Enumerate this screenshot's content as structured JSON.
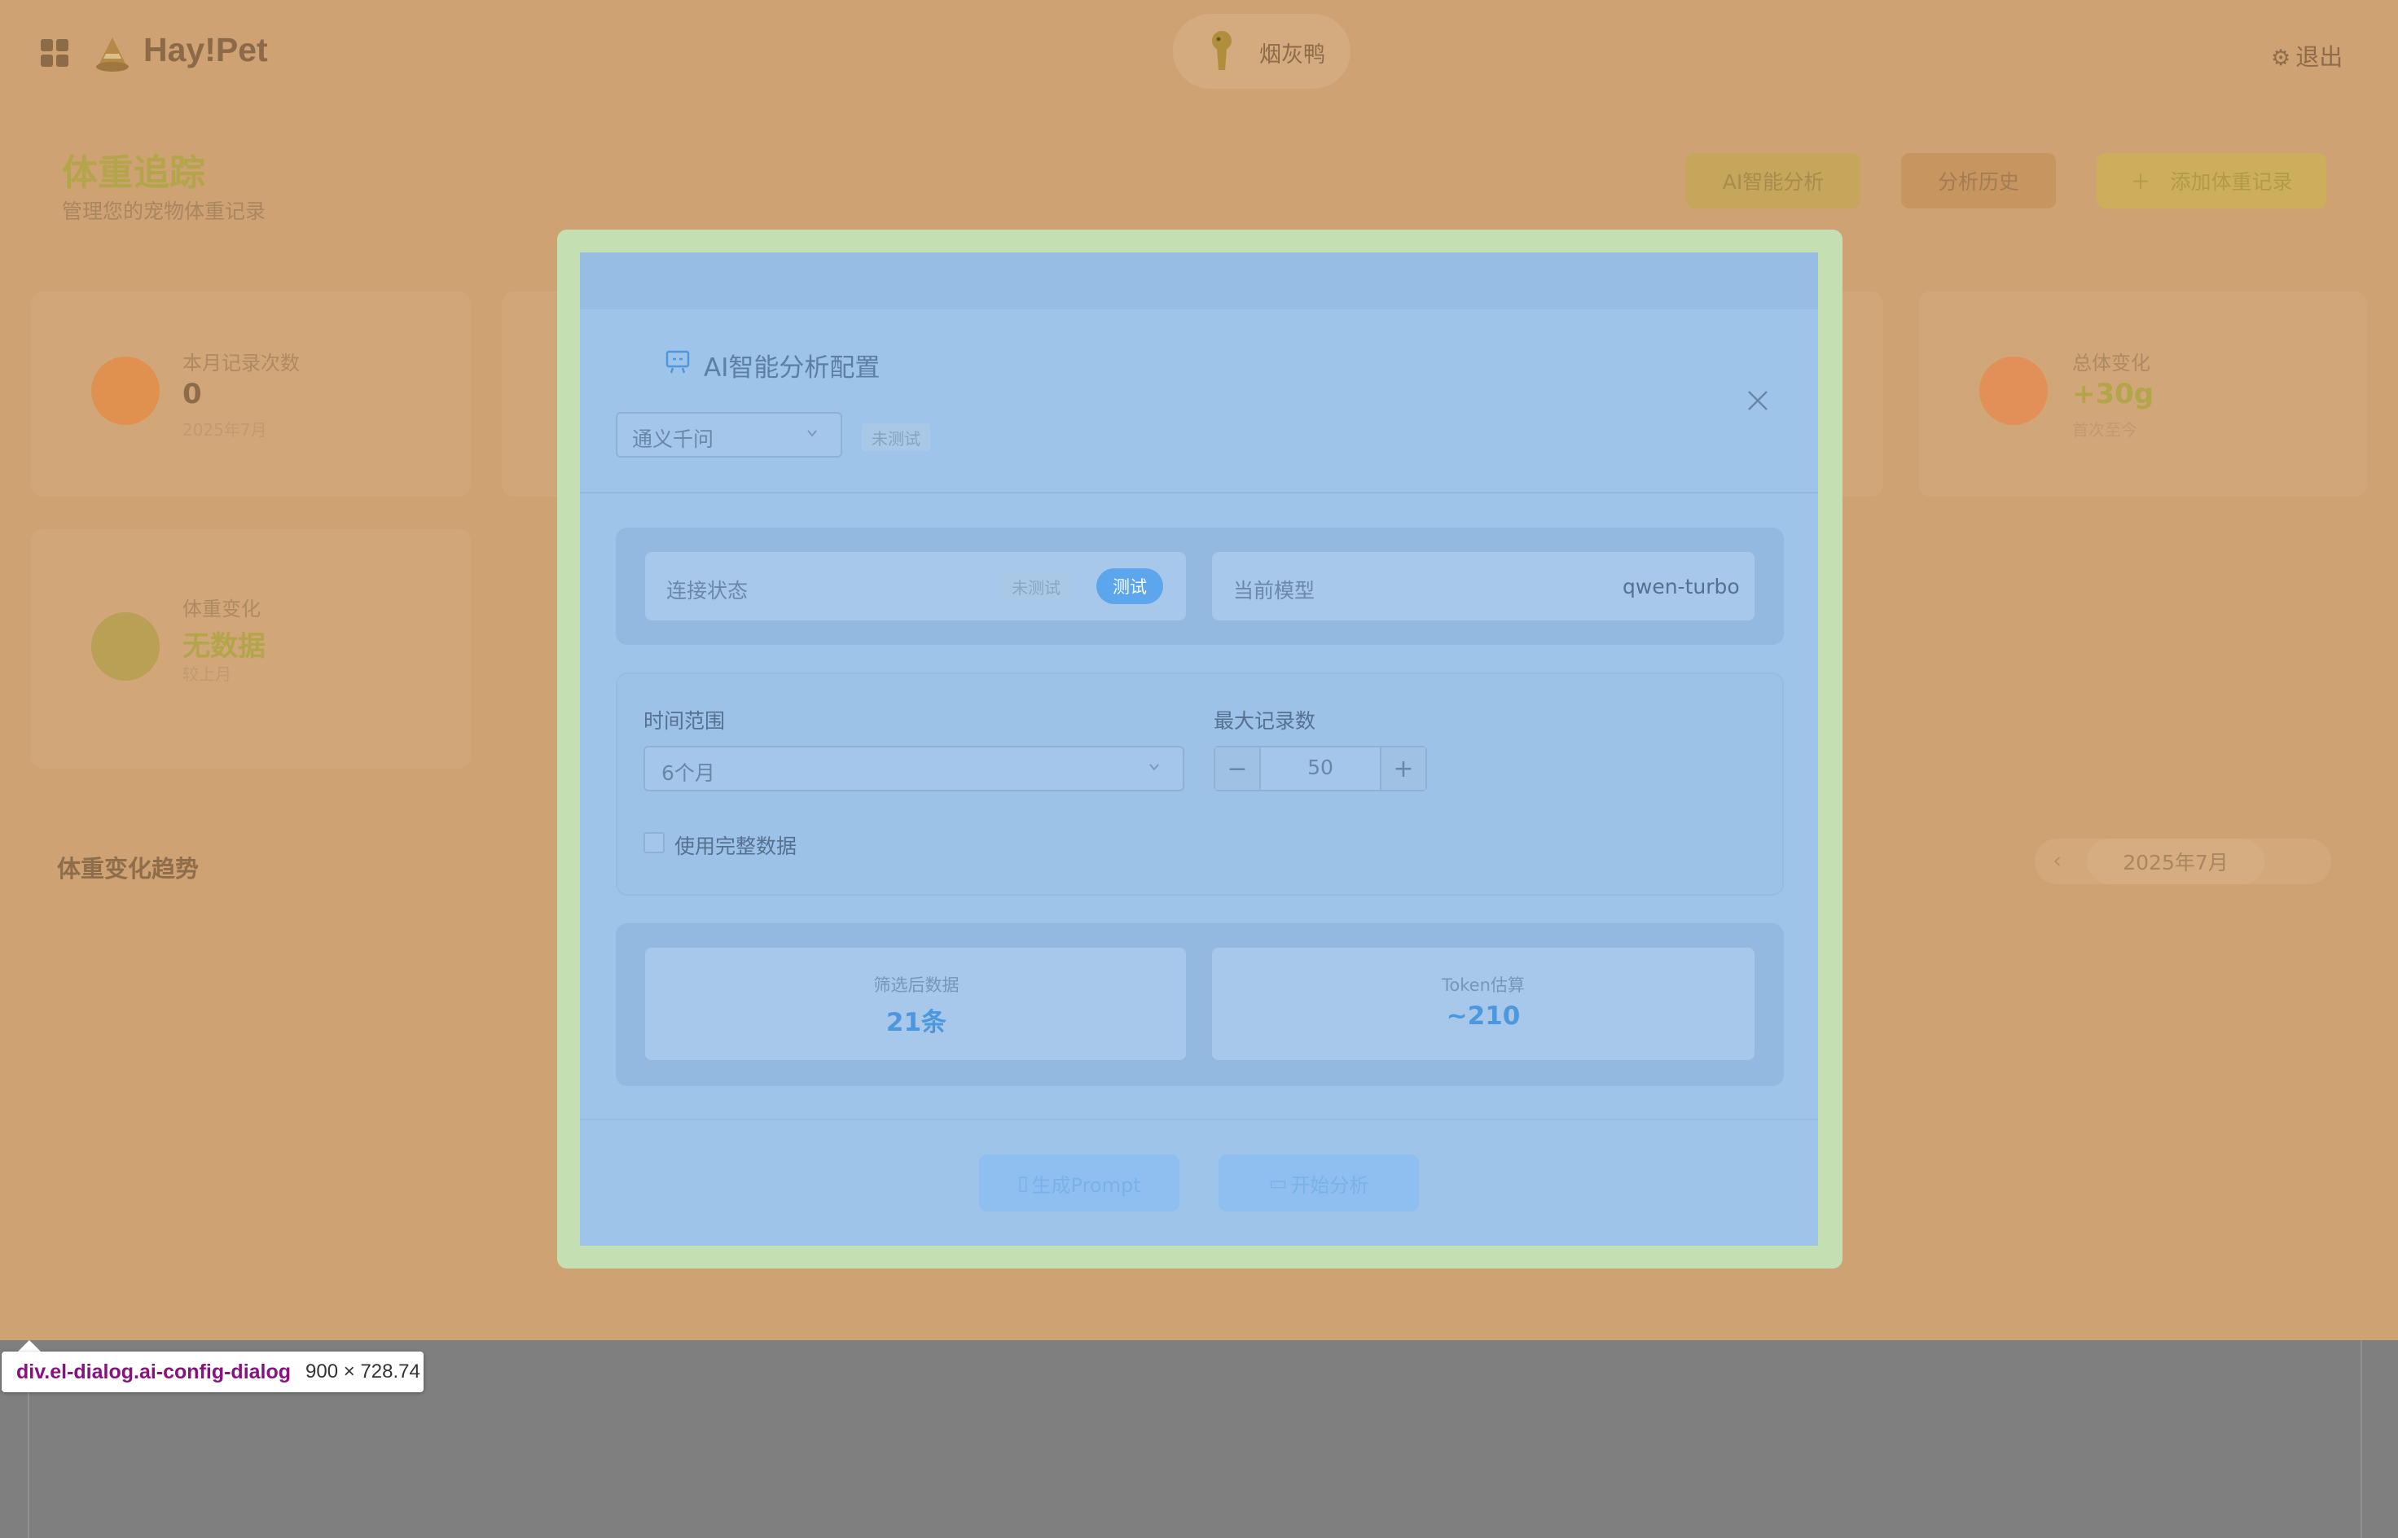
{
  "topbar": {
    "brand": "Hay!Pet",
    "pet_name": "烟灰鸭",
    "logout_label": "退出",
    "icons": [
      "apps-grid-icon",
      "cone-logo-icon",
      "pet-avatar-icon",
      "gear-icon"
    ]
  },
  "header": {
    "title": "体重追踪",
    "subtitle": "管理您的宠物体重记录",
    "buttons": {
      "ai": "AI智能分析",
      "history": "分析历史",
      "add": "添加体重记录"
    }
  },
  "stats": {
    "records": {
      "label": "本月记录次数",
      "value": "0",
      "sub": "2025年7月"
    },
    "total": {
      "label": "总体变化",
      "value": "+30g",
      "sub": "首次至今"
    },
    "weight_change": {
      "label": "体重变化",
      "value": "无数据",
      "sub": "较上月"
    }
  },
  "trend": {
    "title": "体重变化趋势",
    "month": "2025年7月"
  },
  "dialog": {
    "title": "AI智能分析配置",
    "provider": "通义千问",
    "provider_status": "未测试",
    "connection": {
      "label": "连接状态",
      "status": "未测试",
      "test_button": "测试"
    },
    "model": {
      "label": "当前模型",
      "value": "qwen-turbo"
    },
    "time_range": {
      "label": "时间范围",
      "value": "6个月"
    },
    "max_records": {
      "label": "最大记录数",
      "value": "50"
    },
    "use_full_data_label": "使用完整数据",
    "filtered": {
      "label": "筛选后数据",
      "value": "21条"
    },
    "tokens": {
      "label": "Token估算",
      "value": "~210"
    },
    "generate_button": "生成Prompt",
    "start_button": "开始分析"
  },
  "inspector": {
    "selector": "div.el-dialog.ai-config-dialog",
    "size": "900 × 728.74"
  },
  "colors": {
    "page_overlay": "#cfa274",
    "dialog_padding": "#c4e0b3",
    "dialog_content": "#9fc4e9",
    "accent_blue": "#5ba6ec"
  }
}
